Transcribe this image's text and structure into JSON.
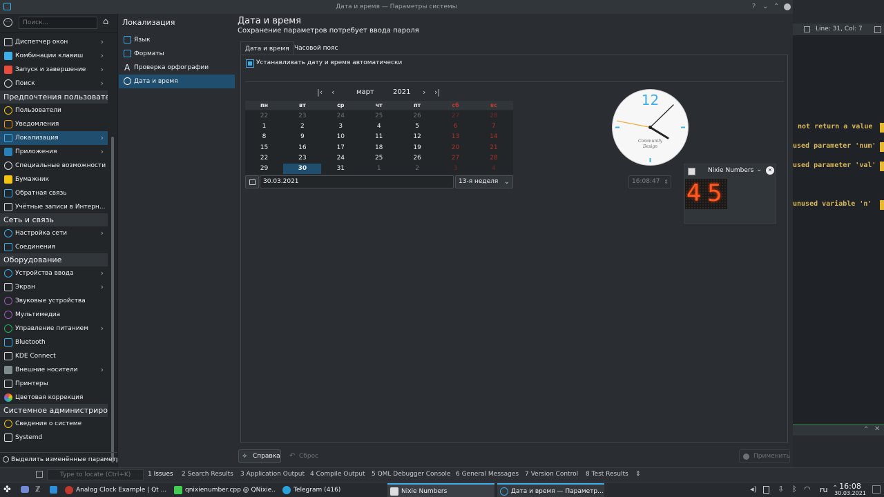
{
  "window": {
    "title": "Дата и время — Параметры системы"
  },
  "sidebar": {
    "search_placeholder": "Поиск...",
    "items_top": [
      {
        "label": "Диспетчер окон"
      },
      {
        "label": "Комбинации клавиш"
      },
      {
        "label": "Запуск и завершение"
      },
      {
        "label": "Поиск"
      }
    ],
    "cat_prefs": "Предпочтения пользовате.",
    "items_prefs": [
      {
        "label": "Пользователи"
      },
      {
        "label": "Уведомления"
      },
      {
        "label": "Локализация"
      },
      {
        "label": "Приложения"
      },
      {
        "label": "Специальные возможности"
      },
      {
        "label": "Бумажник"
      },
      {
        "label": "Обратная связь"
      },
      {
        "label": "Учётные записи в Интерн..."
      }
    ],
    "cat_net": "Сеть и связь",
    "items_net": [
      {
        "label": "Настройка сети"
      },
      {
        "label": "Соединения"
      }
    ],
    "cat_hw": "Оборудование",
    "items_hw": [
      {
        "label": "Устройства ввода"
      },
      {
        "label": "Экран"
      },
      {
        "label": "Звуковые устройства"
      },
      {
        "label": "Мультимедиа"
      },
      {
        "label": "Управление питанием"
      },
      {
        "label": "Bluetooth"
      },
      {
        "label": "KDE Connect"
      },
      {
        "label": "Внешние носители"
      },
      {
        "label": "Принтеры"
      },
      {
        "label": "Цветовая коррекция"
      }
    ],
    "cat_admin": "Системное администриров",
    "items_admin": [
      {
        "label": "Сведения о системе"
      },
      {
        "label": "Systemd"
      }
    ],
    "highlight_changed": "Выделить изменённые параметры"
  },
  "mid": {
    "title": "Локализация",
    "items": [
      {
        "label": "Язык"
      },
      {
        "label": "Форматы"
      },
      {
        "label": "Проверка орфографии"
      },
      {
        "label": "Дата и время"
      }
    ]
  },
  "content": {
    "title": "Дата и время",
    "subtitle": "Сохранение параметров потребует ввода пароля",
    "tabs": [
      "Дата и время",
      "Часовой пояс"
    ],
    "auto_checkbox": "Устанавливать дату и время автоматически",
    "calendar": {
      "month": "март",
      "year": "2021",
      "weekdays": [
        "пн",
        "вт",
        "ср",
        "чт",
        "пт",
        "сб",
        "вс"
      ],
      "rows": [
        [
          "22",
          "23",
          "24",
          "25",
          "26",
          "27",
          "28"
        ],
        [
          "1",
          "2",
          "3",
          "4",
          "5",
          "6",
          "7"
        ],
        [
          "8",
          "9",
          "10",
          "11",
          "12",
          "13",
          "14"
        ],
        [
          "15",
          "16",
          "17",
          "18",
          "19",
          "20",
          "21"
        ],
        [
          "22",
          "23",
          "24",
          "25",
          "26",
          "27",
          "28"
        ],
        [
          "29",
          "30",
          "31",
          "1",
          "2",
          "3",
          "4"
        ]
      ],
      "date_value": "30.03.2021",
      "week_value": "13-я неделя"
    },
    "clock": {
      "twelve": "12",
      "brand1": "Community",
      "brand2": "Design"
    },
    "time_value": "16:08:47",
    "help_button": "Справка",
    "reset_button": "Сброс",
    "apply_button": "Применить"
  },
  "nixie": {
    "title": "Nixie Numbers",
    "digit1": "4",
    "digit2": "5"
  },
  "editor": {
    "line_col": "Line: 31, Col: 7",
    "warnings": [
      "not return a value",
      "used parameter 'num'",
      "used parameter 'val'",
      "unused variable 'n'"
    ]
  },
  "issues_bar": {
    "locate_placeholder": "Type to locate (Ctrl+K)",
    "tabs": [
      "1  Issues",
      "2  Search Results",
      "3  Application Output",
      "4  Compile Output",
      "5  QML Debugger Console",
      "6  General Messages",
      "7  Version Control",
      "8  Test Results"
    ]
  },
  "taskbar": {
    "tasks": [
      "Analog Clock Example | Qt ...",
      "qnixienumber.cpp @ QNixie...",
      "Telegram (416)",
      "Nixie Numbers",
      "Дата и время — Параметр..."
    ],
    "lang": "ru",
    "time": "16:08",
    "date": "30.03.2021"
  }
}
